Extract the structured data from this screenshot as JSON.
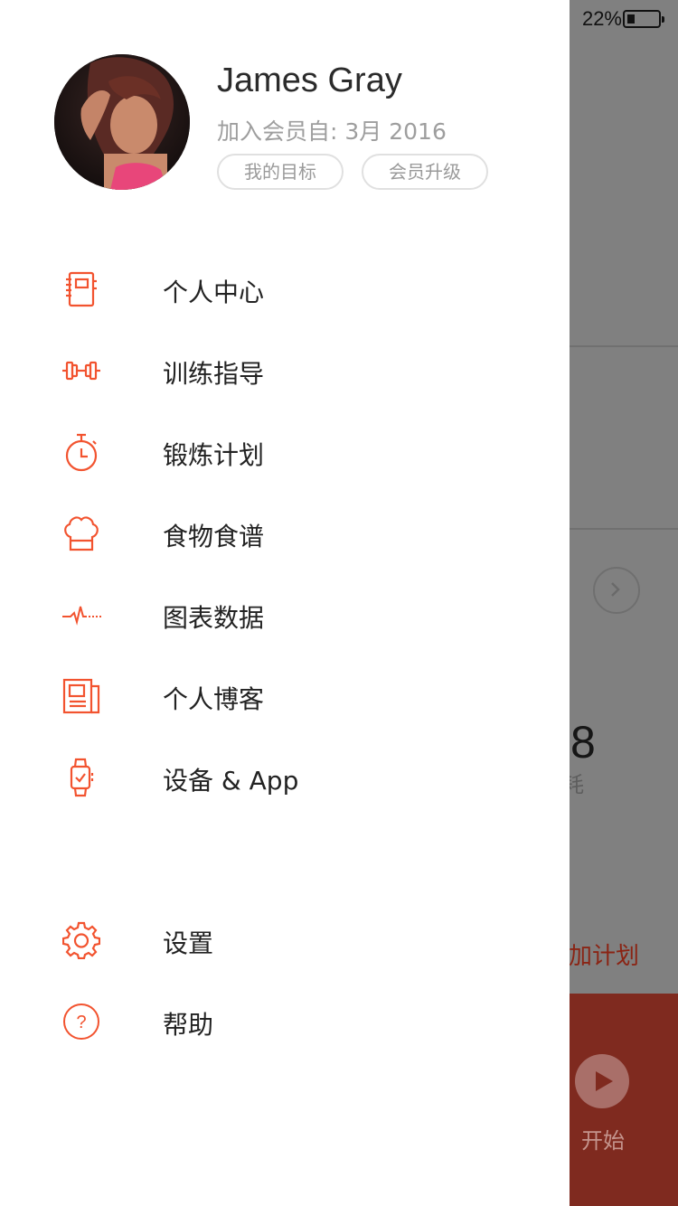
{
  "status_bar": {
    "battery": "22%"
  },
  "profile": {
    "name": "James Gray",
    "member_since": "加入会员自: 3月 2016",
    "goal_button": "我的目标",
    "upgrade_button": "会员升级"
  },
  "menu": [
    {
      "label": "个人中心",
      "icon": "notebook-icon"
    },
    {
      "label": "训练指导",
      "icon": "dumbbell-icon"
    },
    {
      "label": "锻炼计划",
      "icon": "stopwatch-icon"
    },
    {
      "label": "食物食谱",
      "icon": "chef-hat-icon"
    },
    {
      "label": "图表数据",
      "icon": "heartbeat-icon"
    },
    {
      "label": "个人博客",
      "icon": "newspaper-icon"
    },
    {
      "label": "设备 & App",
      "icon": "smartwatch-icon"
    }
  ],
  "bottom_menu": [
    {
      "label": "设置",
      "icon": "gear-icon"
    },
    {
      "label": "帮助",
      "icon": "help-icon"
    }
  ],
  "background": {
    "number": "8",
    "unit": "耗",
    "add_plan": "加计划",
    "start": "开始"
  },
  "colors": {
    "accent": "#f2532f",
    "overlay": "#808080",
    "start_bar": "#7f2a1f"
  }
}
